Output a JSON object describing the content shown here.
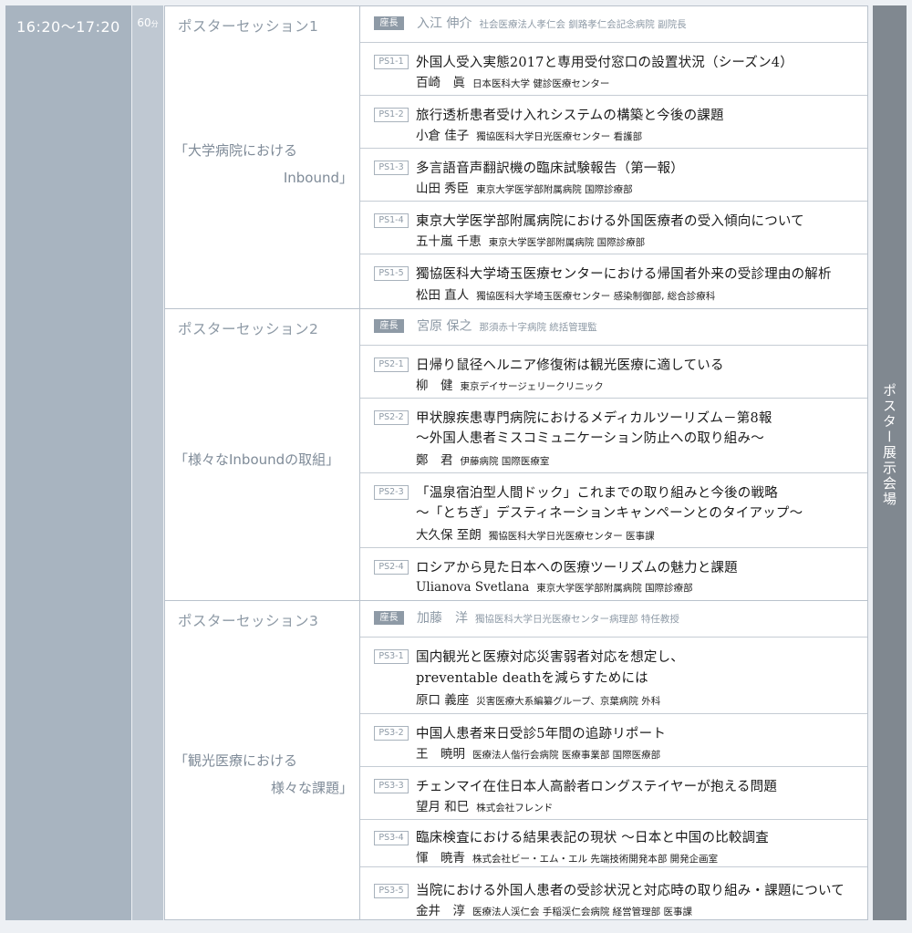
{
  "time": "16:20〜17:20",
  "duration": {
    "value": "60",
    "unit": "分"
  },
  "venue": "ポスター展示会場",
  "sessions": [
    {
      "title": "ポスターセッション1",
      "theme": [
        "「大学病院における",
        "Inbound」"
      ],
      "chair": {
        "badge": "座長",
        "name": "入江 伸介",
        "affiliation": "社会医療法人孝仁会 釧路孝仁会記念病院 副院長"
      },
      "papers": [
        {
          "code": "PS1-1",
          "title": [
            "外国人受入実態2017と専用受付窓口の設置状況（シーズン4）"
          ],
          "author": "百崎　眞",
          "affiliation": "日本医科大学 健診医療センター"
        },
        {
          "code": "PS1-2",
          "title": [
            "旅行透析患者受け入れシステムの構築と今後の課題"
          ],
          "author": "小倉 佳子",
          "affiliation": "獨協医科大学日光医療センター 看護部"
        },
        {
          "code": "PS1-3",
          "title": [
            "多言語音声翻訳機の臨床試験報告（第一報）"
          ],
          "author": "山田 秀臣",
          "affiliation": "東京大学医学部附属病院 国際診療部"
        },
        {
          "code": "PS1-4",
          "title": [
            "東京大学医学部附属病院における外国医療者の受入傾向について"
          ],
          "author": "五十嵐 千恵",
          "affiliation": "東京大学医学部附属病院 国際診療部"
        },
        {
          "code": "PS1-5",
          "title": [
            "獨協医科大学埼玉医療センターにおける帰国者外来の受診理由の解析"
          ],
          "author": "松田 直人",
          "affiliation": "獨協医科大学埼玉医療センター 感染制御部, 総合診療科"
        }
      ]
    },
    {
      "title": "ポスターセッション2",
      "theme": [
        "「様々なInboundの取組」"
      ],
      "chair": {
        "badge": "座長",
        "name": "宮原 保之",
        "affiliation": "那須赤十字病院 統括管理監"
      },
      "papers": [
        {
          "code": "PS2-1",
          "title": [
            "日帰り鼠径ヘルニア修復術は観光医療に適している"
          ],
          "author": "柳　健",
          "affiliation": "東京デイサージェリークリニック"
        },
        {
          "code": "PS2-2",
          "title": [
            "甲状腺疾患専門病院におけるメディカルツーリズム－第8報",
            "〜外国人患者ミスコミュニケーション防止への取り組み〜"
          ],
          "author": "鄭　君",
          "affiliation": "伊藤病院 国際医療室"
        },
        {
          "code": "PS2-3",
          "title": [
            "「温泉宿泊型人間ドック」これまでの取り組みと今後の戦略",
            "〜「とちぎ」デスティネーションキャンペーンとのタイアップ〜"
          ],
          "author": "大久保 至朗",
          "affiliation": "獨協医科大学日光医療センター 医事課"
        },
        {
          "code": "PS2-4",
          "title": [
            "ロシアから見た日本への医療ツーリズムの魅力と課題"
          ],
          "author": "Ulianova Svetlana",
          "affiliation": "東京大学医学部附属病院 国際診療部"
        }
      ]
    },
    {
      "title": "ポスターセッション3",
      "theme": [
        "「観光医療における",
        "様々な課題」"
      ],
      "chair": {
        "badge": "座長",
        "name": "加藤　洋",
        "affiliation": "獨協医科大学日光医療センター病理部 特任教授"
      },
      "papers": [
        {
          "code": "PS3-1",
          "title": [
            "国内観光と医療対応災害弱者対応を想定し、",
            "preventable deathを減らすためには"
          ],
          "author": "原口 義座",
          "affiliation": "災害医療大系編纂グループ、京葉病院 外科"
        },
        {
          "code": "PS3-2",
          "title": [
            "中国人患者来日受診5年間の追跡リポート"
          ],
          "author": "王　暁明",
          "affiliation": "医療法人偕行会病院 医療事業部 国際医療部"
        },
        {
          "code": "PS3-3",
          "title": [
            "チェンマイ在住日本人高齢者ロングステイヤーが抱える問題"
          ],
          "author": "望月 和巳",
          "affiliation": "株式会社フレンド"
        },
        {
          "code": "PS3-4",
          "title": [
            "臨床検査における結果表記の現状 〜日本と中国の比較調査"
          ],
          "author": "惲　暁青",
          "affiliation": "株式会社ビー・エム・エル 先端技術開発本部 開発企画室"
        },
        {
          "code": "PS3-5",
          "title": [
            "当院における外国人患者の受診状況と対応時の取り組み・課題について"
          ],
          "author": "金井　淳",
          "affiliation": "医療法人渓仁会 手稲渓仁会病院 経営管理部 医事課"
        }
      ]
    }
  ]
}
